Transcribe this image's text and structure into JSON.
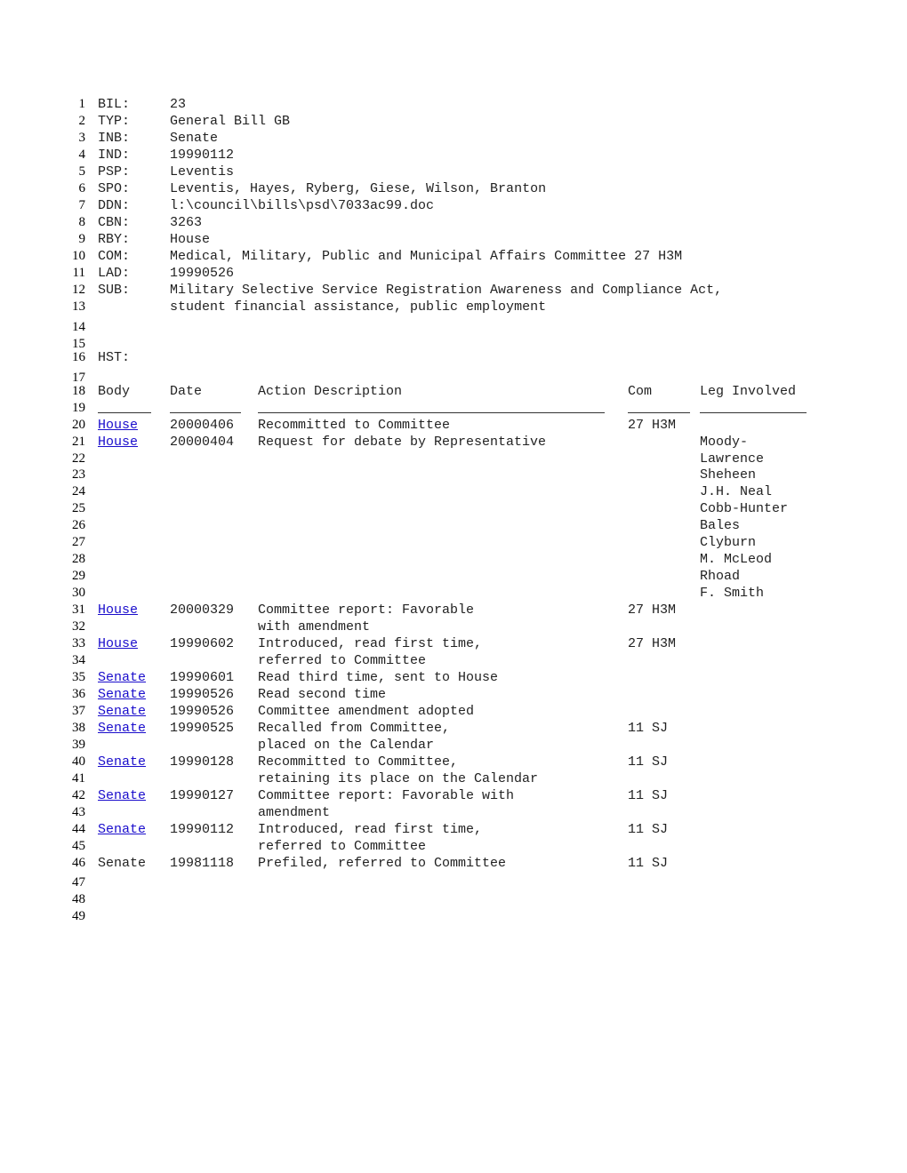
{
  "colors": {
    "link": "#1a0dcc",
    "text": "#222222"
  },
  "header_fields": [
    {
      "key": "BIL:",
      "value": "23"
    },
    {
      "key": "TYP:",
      "value": "General Bill GB"
    },
    {
      "key": "INB:",
      "value": "Senate"
    },
    {
      "key": "IND:",
      "value": "19990112"
    },
    {
      "key": "PSP:",
      "value": "Leventis"
    },
    {
      "key": "SPO:",
      "value": "Leventis, Hayes, Ryberg, Giese, Wilson, Branton"
    },
    {
      "key": "DDN:",
      "value": "l:\\council\\bills\\psd\\7033ac99.doc"
    },
    {
      "key": "CBN:",
      "value": "3263"
    },
    {
      "key": "RBY:",
      "value": "House"
    },
    {
      "key": "COM:",
      "value": "Medical, Military, Public and Municipal Affairs Committee 27 H3M"
    },
    {
      "key": "LAD:",
      "value": "19990526"
    },
    {
      "key": "SUB:",
      "value": "Military Selective Service Registration Awareness and Compliance Act,"
    },
    {
      "key": "",
      "value": "student financial assistance, public employment"
    }
  ],
  "history_label": "HST:",
  "table": {
    "headers": {
      "body": "Body",
      "date": "Date",
      "action": "Action Description",
      "com": "Com",
      "leg": "Leg Involved"
    },
    "rows": [
      {
        "body": "House",
        "link": true,
        "date": "20000406",
        "action": [
          "Recommitted to Committee"
        ],
        "com": "27 H3M",
        "leg": []
      },
      {
        "body": "House",
        "link": true,
        "date": "20000404",
        "action": [
          "Request for debate by Representative"
        ],
        "com": "",
        "leg": [
          "Moody-",
          "Lawrence",
          "Sheheen",
          "J.H. Neal",
          "Cobb-Hunter",
          "Bales",
          "Clyburn",
          "M. McLeod",
          "Rhoad",
          "F. Smith"
        ]
      },
      {
        "body": "House",
        "link": true,
        "date": "20000329",
        "action": [
          "Committee report: Favorable",
          "with amendment"
        ],
        "com": "27 H3M",
        "leg": []
      },
      {
        "body": "House",
        "link": true,
        "date": "19990602",
        "action": [
          "Introduced, read first time,",
          "referred to Committee"
        ],
        "com": "27 H3M",
        "leg": []
      },
      {
        "body": "Senate",
        "link": true,
        "date": "19990601",
        "action": [
          "Read third time, sent to House"
        ],
        "com": "",
        "leg": []
      },
      {
        "body": "Senate",
        "link": true,
        "date": "19990526",
        "action": [
          "Read second time"
        ],
        "com": "",
        "leg": []
      },
      {
        "body": "Senate",
        "link": true,
        "date": "19990526",
        "action": [
          "Committee amendment adopted"
        ],
        "com": "",
        "leg": []
      },
      {
        "body": "Senate",
        "link": true,
        "date": "19990525",
        "action": [
          "Recalled from Committee,",
          "placed on the Calendar"
        ],
        "com": "11 SJ",
        "leg": []
      },
      {
        "body": "Senate",
        "link": true,
        "date": "19990128",
        "action": [
          "Recommitted to Committee,",
          "retaining its place on the Calendar"
        ],
        "com": "11 SJ",
        "leg": []
      },
      {
        "body": "Senate",
        "link": true,
        "date": "19990127",
        "action": [
          "Committee report: Favorable with",
          "amendment"
        ],
        "com": "11 SJ",
        "leg": []
      },
      {
        "body": "Senate",
        "link": true,
        "date": "19990112",
        "action": [
          "Introduced, read first time,",
          "referred to Committee"
        ],
        "com": "11 SJ",
        "leg": []
      },
      {
        "body": "Senate",
        "link": false,
        "date": "19981118",
        "action": [
          "Prefiled, referred to Committee"
        ],
        "com": "11 SJ",
        "leg": []
      }
    ]
  },
  "line_numbers": [
    "1",
    "2",
    "3",
    "4",
    "5",
    "6",
    "7",
    "8",
    "9",
    "10",
    "11",
    "12",
    "13",
    "14",
    "15",
    "16",
    "17",
    "18",
    "19",
    "20",
    "21",
    "22",
    "23",
    "24",
    "25",
    "26",
    "27",
    "28",
    "29",
    "30",
    "31",
    "32",
    "33",
    "34",
    "35",
    "36",
    "37",
    "38",
    "39",
    "40",
    "41",
    "42",
    "43",
    "44",
    "45",
    "46",
    "47",
    "48",
    "49"
  ]
}
